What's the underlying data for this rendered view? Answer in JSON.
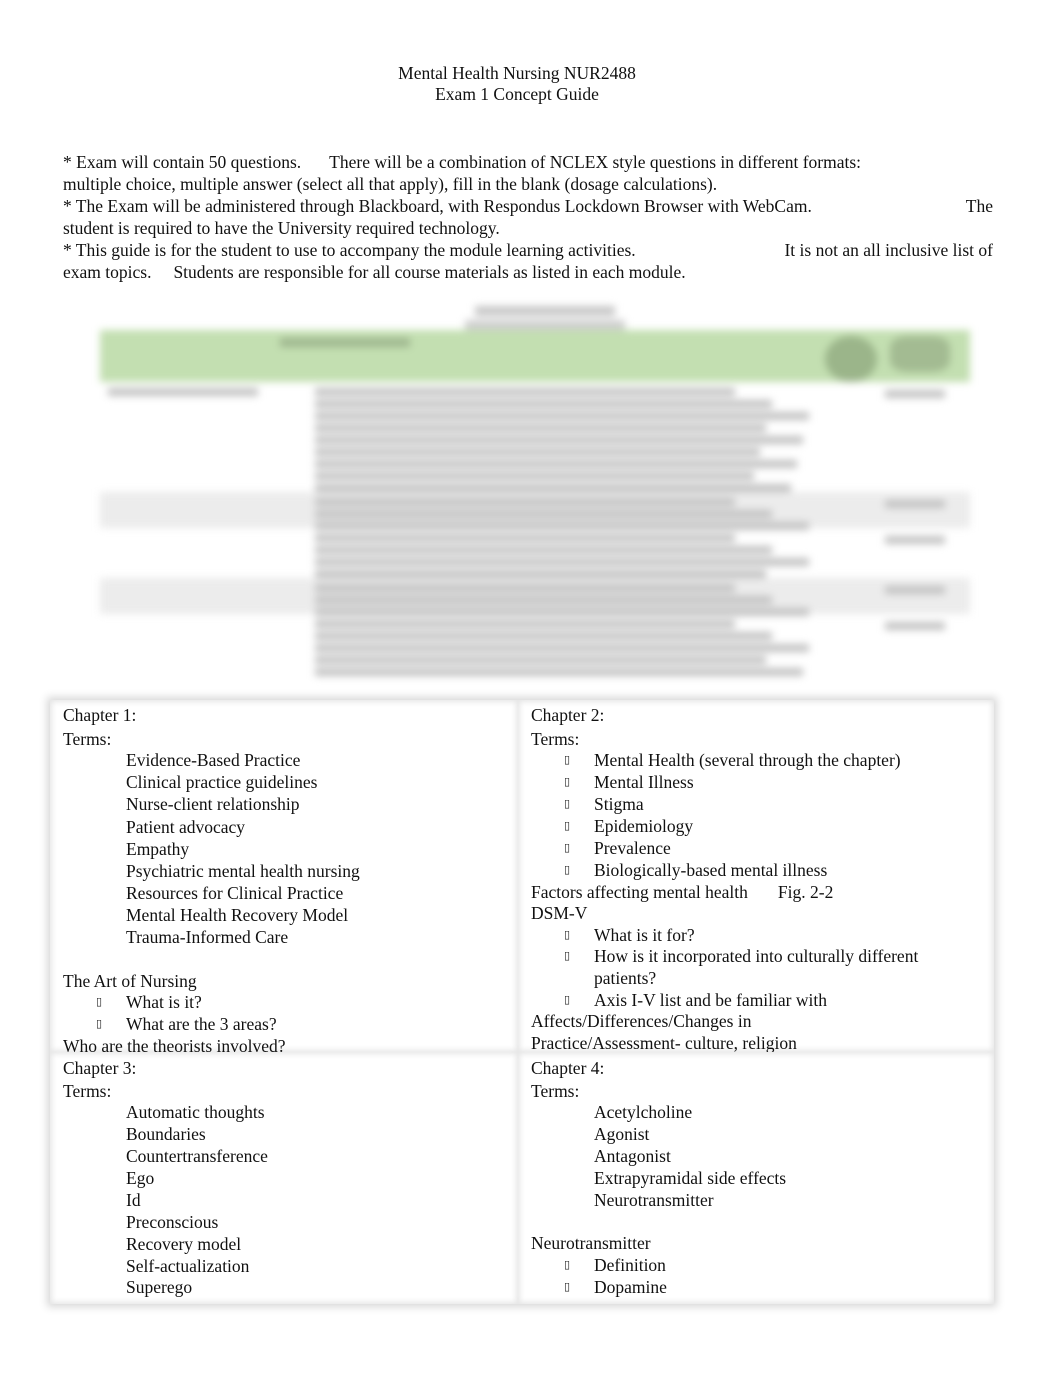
{
  "document": {
    "title_line1": "Mental Health Nursing NUR2488",
    "title_line2": "Exam 1 Concept Guide",
    "intro": [
      [
        "* Exam will contain 50 questions.",
        "There will be a combination of NCLEX style questions in different formats:"
      ],
      [
        "multiple choice, multiple answer (select all that apply), fill in the blank (dosage calculations)."
      ],
      [
        "* The Exam will be administered through Blackboard, with Respondus Lockdown Browser with WebCam.",
        "The"
      ],
      [
        "student is required to have the University required technology."
      ],
      [
        "* This guide is for the student to use to accompany the module learning activities.",
        "It is not an all inclusive list of"
      ],
      [
        "exam topics.",
        "Students are responsible for all course materials as listed in each module."
      ]
    ],
    "blurred_table": {
      "header_color": "#c3dfb1",
      "note": "content illegible (blurred)"
    },
    "bullet_glyph": "▯",
    "chapters": [
      {
        "heading": "Chapter 1:",
        "terms_label": "Terms:",
        "terms": [
          "Evidence-Based Practice",
          "Clinical practice guidelines",
          "Nurse-client relationship",
          "Patient advocacy",
          "Empathy",
          "Psychiatric mental health nursing",
          "Resources for Clinical Practice",
          "Mental Health Recovery Model",
          "Trauma-Informed Care"
        ],
        "section": "The Art of Nursing",
        "section_bullets": [
          "What is it?",
          "What are the 3 areas?"
        ],
        "footer": "Who are the theorists involved?"
      },
      {
        "heading": "Chapter 2:",
        "terms_label": "Terms:",
        "terms": [
          "Mental Health (several through the chapter)",
          "Mental Illness",
          "Stigma",
          "Epidemiology",
          "Prevalence",
          "Biologically-based mental illness"
        ],
        "factors": "Factors affecting mental health",
        "factors_fig": "Fig. 2-2",
        "section": "DSM-V",
        "section_bullets": [
          "What is it for?",
          "How is it incorporated into culturally different",
          "patients?",
          "Axis I-V list and be familiar with"
        ],
        "footer_lines": [
          "Affects/Differences/Changes in",
          "Practice/Assessment- culture, religion"
        ]
      },
      {
        "heading": "Chapter 3:",
        "terms_label": "Terms:",
        "terms": [
          "Automatic thoughts",
          "Boundaries",
          "Countertransference",
          "Ego",
          "Id",
          "Preconscious",
          "Recovery model",
          "Self-actualization",
          "Superego"
        ]
      },
      {
        "heading": "Chapter 4:",
        "terms_label": "Terms:",
        "terms": [
          "Acetylcholine",
          "Agonist",
          "Antagonist",
          "Extrapyramidal side effects",
          "Neurotransmitter"
        ],
        "section": "Neurotransmitter",
        "section_bullets": [
          "Definition",
          "Dopamine"
        ]
      }
    ]
  }
}
